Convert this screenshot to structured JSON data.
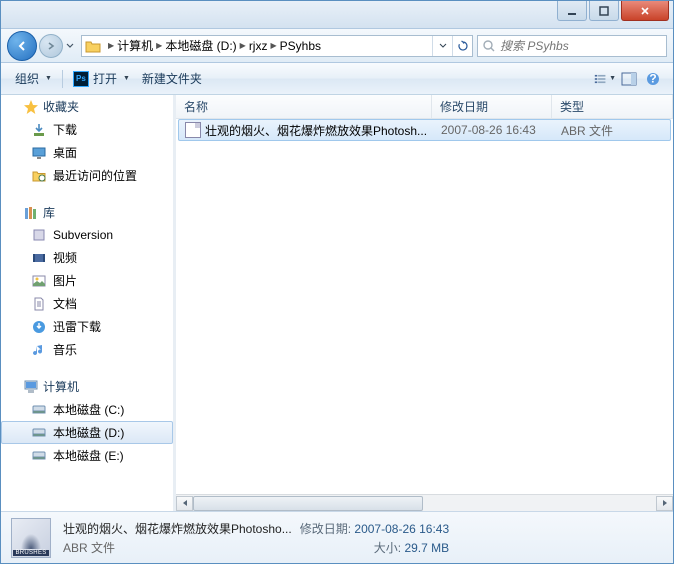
{
  "breadcrumb": {
    "items": [
      "计算机",
      "本地磁盘 (D:)",
      "rjxz",
      "PSyhbs"
    ]
  },
  "search": {
    "placeholder": "搜索 PSyhbs"
  },
  "toolbar": {
    "organize": "组织",
    "open": "打开",
    "newfolder": "新建文件夹"
  },
  "sidebar": {
    "favorites": {
      "label": "收藏夹",
      "items": [
        "下载",
        "桌面",
        "最近访问的位置"
      ]
    },
    "libraries": {
      "label": "库",
      "items": [
        "Subversion",
        "视频",
        "图片",
        "文档",
        "迅雷下载",
        "音乐"
      ]
    },
    "computer": {
      "label": "计算机",
      "items": [
        "本地磁盘 (C:)",
        "本地磁盘 (D:)",
        "本地磁盘 (E:)"
      ]
    }
  },
  "columns": {
    "name": "名称",
    "date": "修改日期",
    "type": "类型"
  },
  "files": [
    {
      "name": "壮观的烟火、烟花爆炸燃放效果Photosh...",
      "date": "2007-08-26 16:43",
      "type": "ABR 文件"
    }
  ],
  "details": {
    "title": "壮观的烟火、烟花爆炸燃放效果Photosho...",
    "subtitle": "ABR 文件",
    "date_label": "修改日期:",
    "date_value": "2007-08-26 16:43",
    "size_label": "大小:",
    "size_value": "29.7 MB",
    "thumb_label": "BRUSHES"
  }
}
